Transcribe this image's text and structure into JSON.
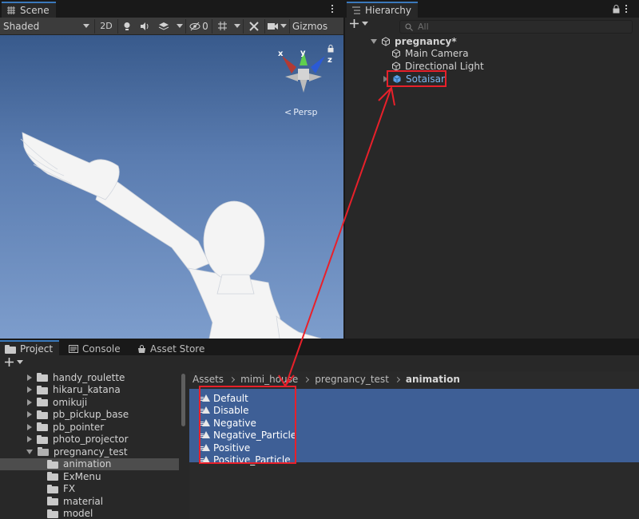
{
  "scene": {
    "tab_label": "Scene",
    "shading_mode": "Shaded",
    "mode_2d": "2D",
    "hidden_count": "0",
    "gizmos_label": "Gizmos",
    "axis_x": "x",
    "axis_y": "y",
    "axis_z": "z",
    "projection_label": "Persp",
    "icons": [
      "grid-icon",
      "light-icon",
      "audio-icon",
      "effects-icon",
      "visibility-icon",
      "grid-snap-icon",
      "tools-icon",
      "camera-icon",
      "lock-icon"
    ]
  },
  "hierarchy": {
    "tab_label": "Hierarchy",
    "search_placeholder": "All",
    "scene_name": "pregnancy*",
    "items": [
      {
        "label": "Main Camera",
        "icon": "gameobject-icon"
      },
      {
        "label": "Directional Light",
        "icon": "gameobject-icon"
      },
      {
        "label": "Sotaisan",
        "icon": "prefab-icon"
      }
    ]
  },
  "project": {
    "tabs": [
      {
        "label": "Project",
        "icon": "folder-icon"
      },
      {
        "label": "Console",
        "icon": "console-icon"
      },
      {
        "label": "Asset Store",
        "icon": "store-icon"
      }
    ],
    "folders": [
      {
        "label": "handy_roulette"
      },
      {
        "label": "hikaru_katana"
      },
      {
        "label": "omikuji"
      },
      {
        "label": "pb_pickup_base"
      },
      {
        "label": "pb_pointer"
      },
      {
        "label": "photo_projector"
      },
      {
        "label": "pregnancy_test"
      },
      {
        "label": "animation"
      },
      {
        "label": "ExMenu"
      },
      {
        "label": "FX"
      },
      {
        "label": "material"
      },
      {
        "label": "model"
      }
    ],
    "breadcrumb": [
      "Assets",
      "mimi_house",
      "pregnancy_test",
      "animation"
    ],
    "assets": [
      "Default",
      "Disable",
      "Negative",
      "Negative_Particle",
      "Positive",
      "Positive_Particle"
    ]
  },
  "colors": {
    "highlight_red": "#e8202a",
    "selection_blue": "#3e5f96",
    "sky_top": "#385a8c",
    "sky_bottom": "#7d9dcc"
  }
}
